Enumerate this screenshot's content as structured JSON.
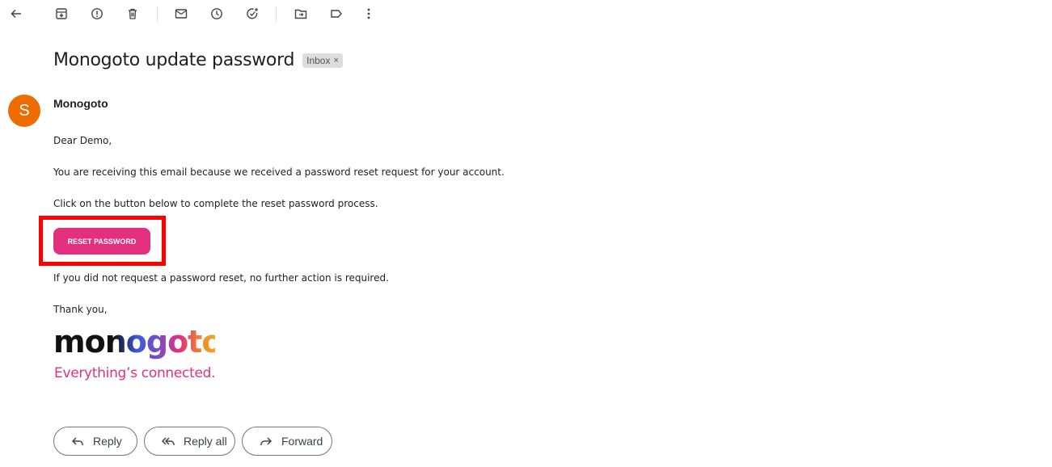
{
  "toolbar": {
    "icons": [
      "back-arrow-icon",
      "archive-icon",
      "report-spam-icon",
      "delete-icon",
      "mark-unread-icon",
      "snooze-icon",
      "add-to-tasks-icon",
      "move-to-icon",
      "label-icon",
      "more-options-icon"
    ]
  },
  "email": {
    "subject": "Monogoto update password",
    "label": "Inbox",
    "label_close": "×",
    "sender_initial": "S",
    "sender_name": "Monogoto",
    "greeting": "Dear Demo,",
    "line1": "You are receiving this email because we received a password reset request for your account.",
    "line2": "Click on the button below to complete the reset password process.",
    "button_label": "RESET PASSWORD",
    "line3": "If you did not request a password reset, no further action is required.",
    "signoff": "Thank you,",
    "logo_text": "monogoto",
    "tagline": "Everything’s connected."
  },
  "actions": {
    "reply": "Reply",
    "reply_all": "Reply all",
    "forward": "Forward"
  },
  "colors": {
    "avatar": "#ef6c00",
    "button": "#e3307e",
    "highlight": "#ff0000"
  }
}
